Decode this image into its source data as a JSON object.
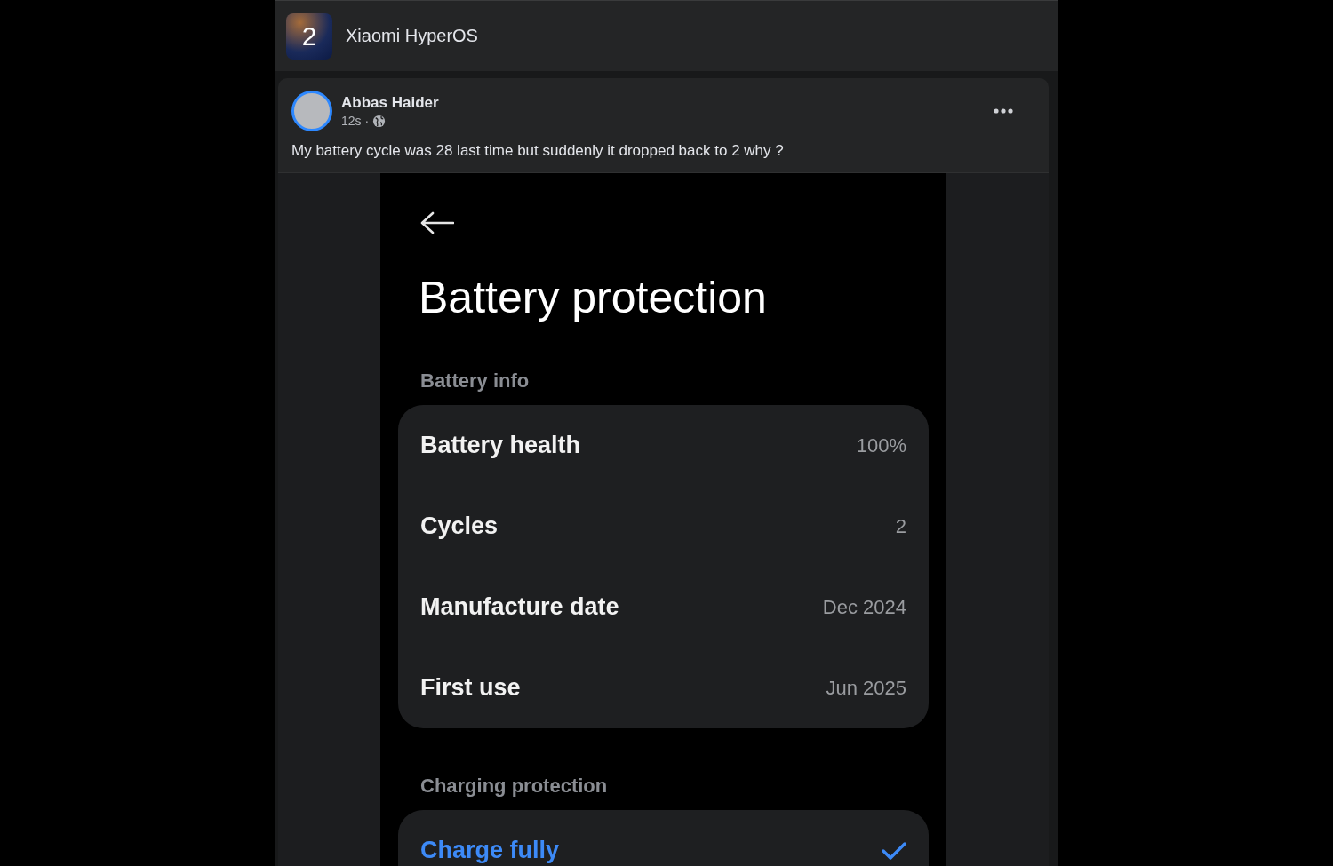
{
  "group": {
    "logo_text": "2",
    "name": "Xiaomi HyperOS"
  },
  "post": {
    "author": "Abbas Haider",
    "time": "12s",
    "separator": "·",
    "text": "My battery cycle was 28 last time but suddenly it dropped back to 2 why ?",
    "screenshot": {
      "title": "Battery protection",
      "sections": [
        {
          "heading": "Battery info",
          "rows": [
            {
              "kind": "info",
              "label": "Battery health",
              "value": "100%"
            },
            {
              "kind": "info",
              "label": "Cycles",
              "value": "2"
            },
            {
              "kind": "info",
              "label": "Manufacture date",
              "value": "Dec 2024"
            },
            {
              "kind": "info",
              "label": "First use",
              "value": "Jun 2025"
            }
          ]
        },
        {
          "heading": "Charging protection",
          "rows": [
            {
              "kind": "option",
              "label": "Charge fully",
              "selected": true
            }
          ]
        }
      ]
    }
  }
}
